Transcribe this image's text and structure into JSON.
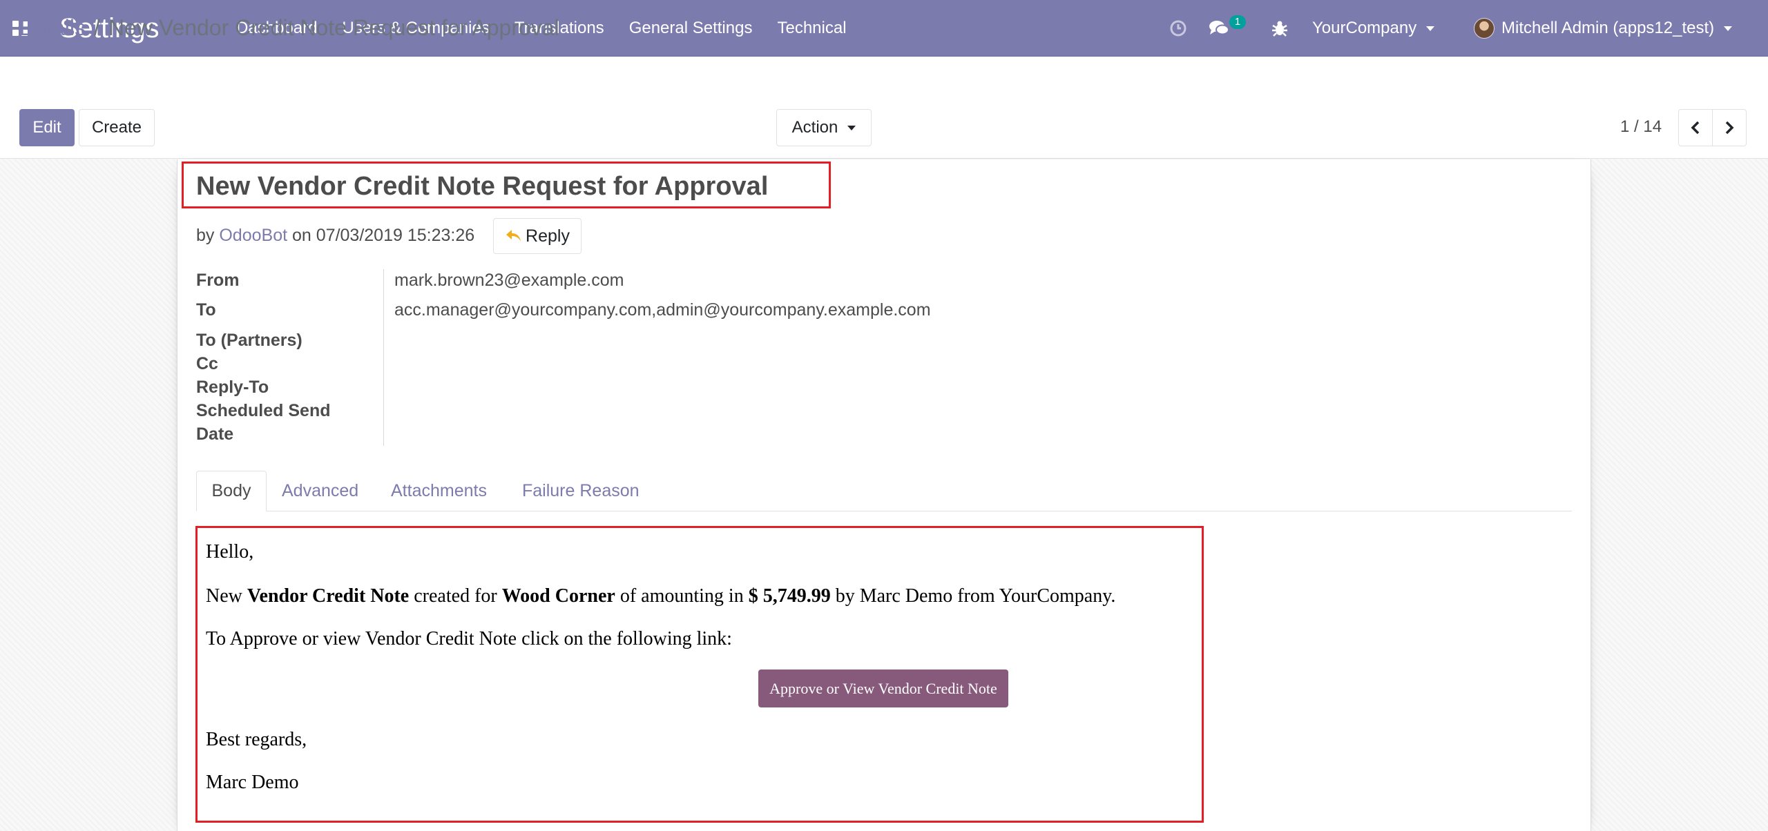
{
  "navbar": {
    "brand": "Settings",
    "menu": [
      "Dashboard",
      "Users & Companies",
      "Translations",
      "General Settings",
      "Technical"
    ],
    "chat_badge": "1",
    "company": "YourCompany",
    "user": "Mitchell Admin (apps12_test)",
    "bg_color": "#7c7bad"
  },
  "control_panel": {
    "breadcrumb_parent": "Emails",
    "breadcrumb_separator": "/",
    "breadcrumb_current": "New Vendor Credit Note Request for Approval",
    "edit_label": "Edit",
    "create_label": "Create",
    "action_label": "Action",
    "pager_value": "1 / 14"
  },
  "mail": {
    "subject": "New Vendor Credit Note Request for Approval",
    "by_prefix": "by",
    "author": "OdooBot",
    "on_prefix": "on",
    "date": "07/03/2019 15:23:26",
    "reply_label": "Reply",
    "fields": {
      "from_label": "From",
      "from_value": "mark.brown23@example.com",
      "to_label": "To",
      "to_value": "acc.manager@yourcompany.com,admin@yourcompany.example.com",
      "to_partners_label": "To (Partners)",
      "cc_label": "Cc",
      "reply_to_label": "Reply-To",
      "scheduled_send_label": "Scheduled Send",
      "date_label": "Date"
    }
  },
  "tabs": [
    "Body",
    "Advanced",
    "Attachments",
    "Failure Reason"
  ],
  "body": {
    "greeting": "Hello,",
    "line1_pre": "New",
    "line1_doc": "Vendor Credit Note",
    "line1_mid": "created for",
    "line1_partner": "Wood Corner",
    "line1_mid2": "of amounting in",
    "line1_amount": "$ 5,749.99",
    "line1_post": "by Marc Demo from YourCompany.",
    "line2": "To Approve or view Vendor Credit Note click on the following link:",
    "button_label": "Approve or View Vendor Credit Note",
    "closing": "Best regards,",
    "signature": "Marc Demo",
    "button_color": "#875a7b"
  }
}
